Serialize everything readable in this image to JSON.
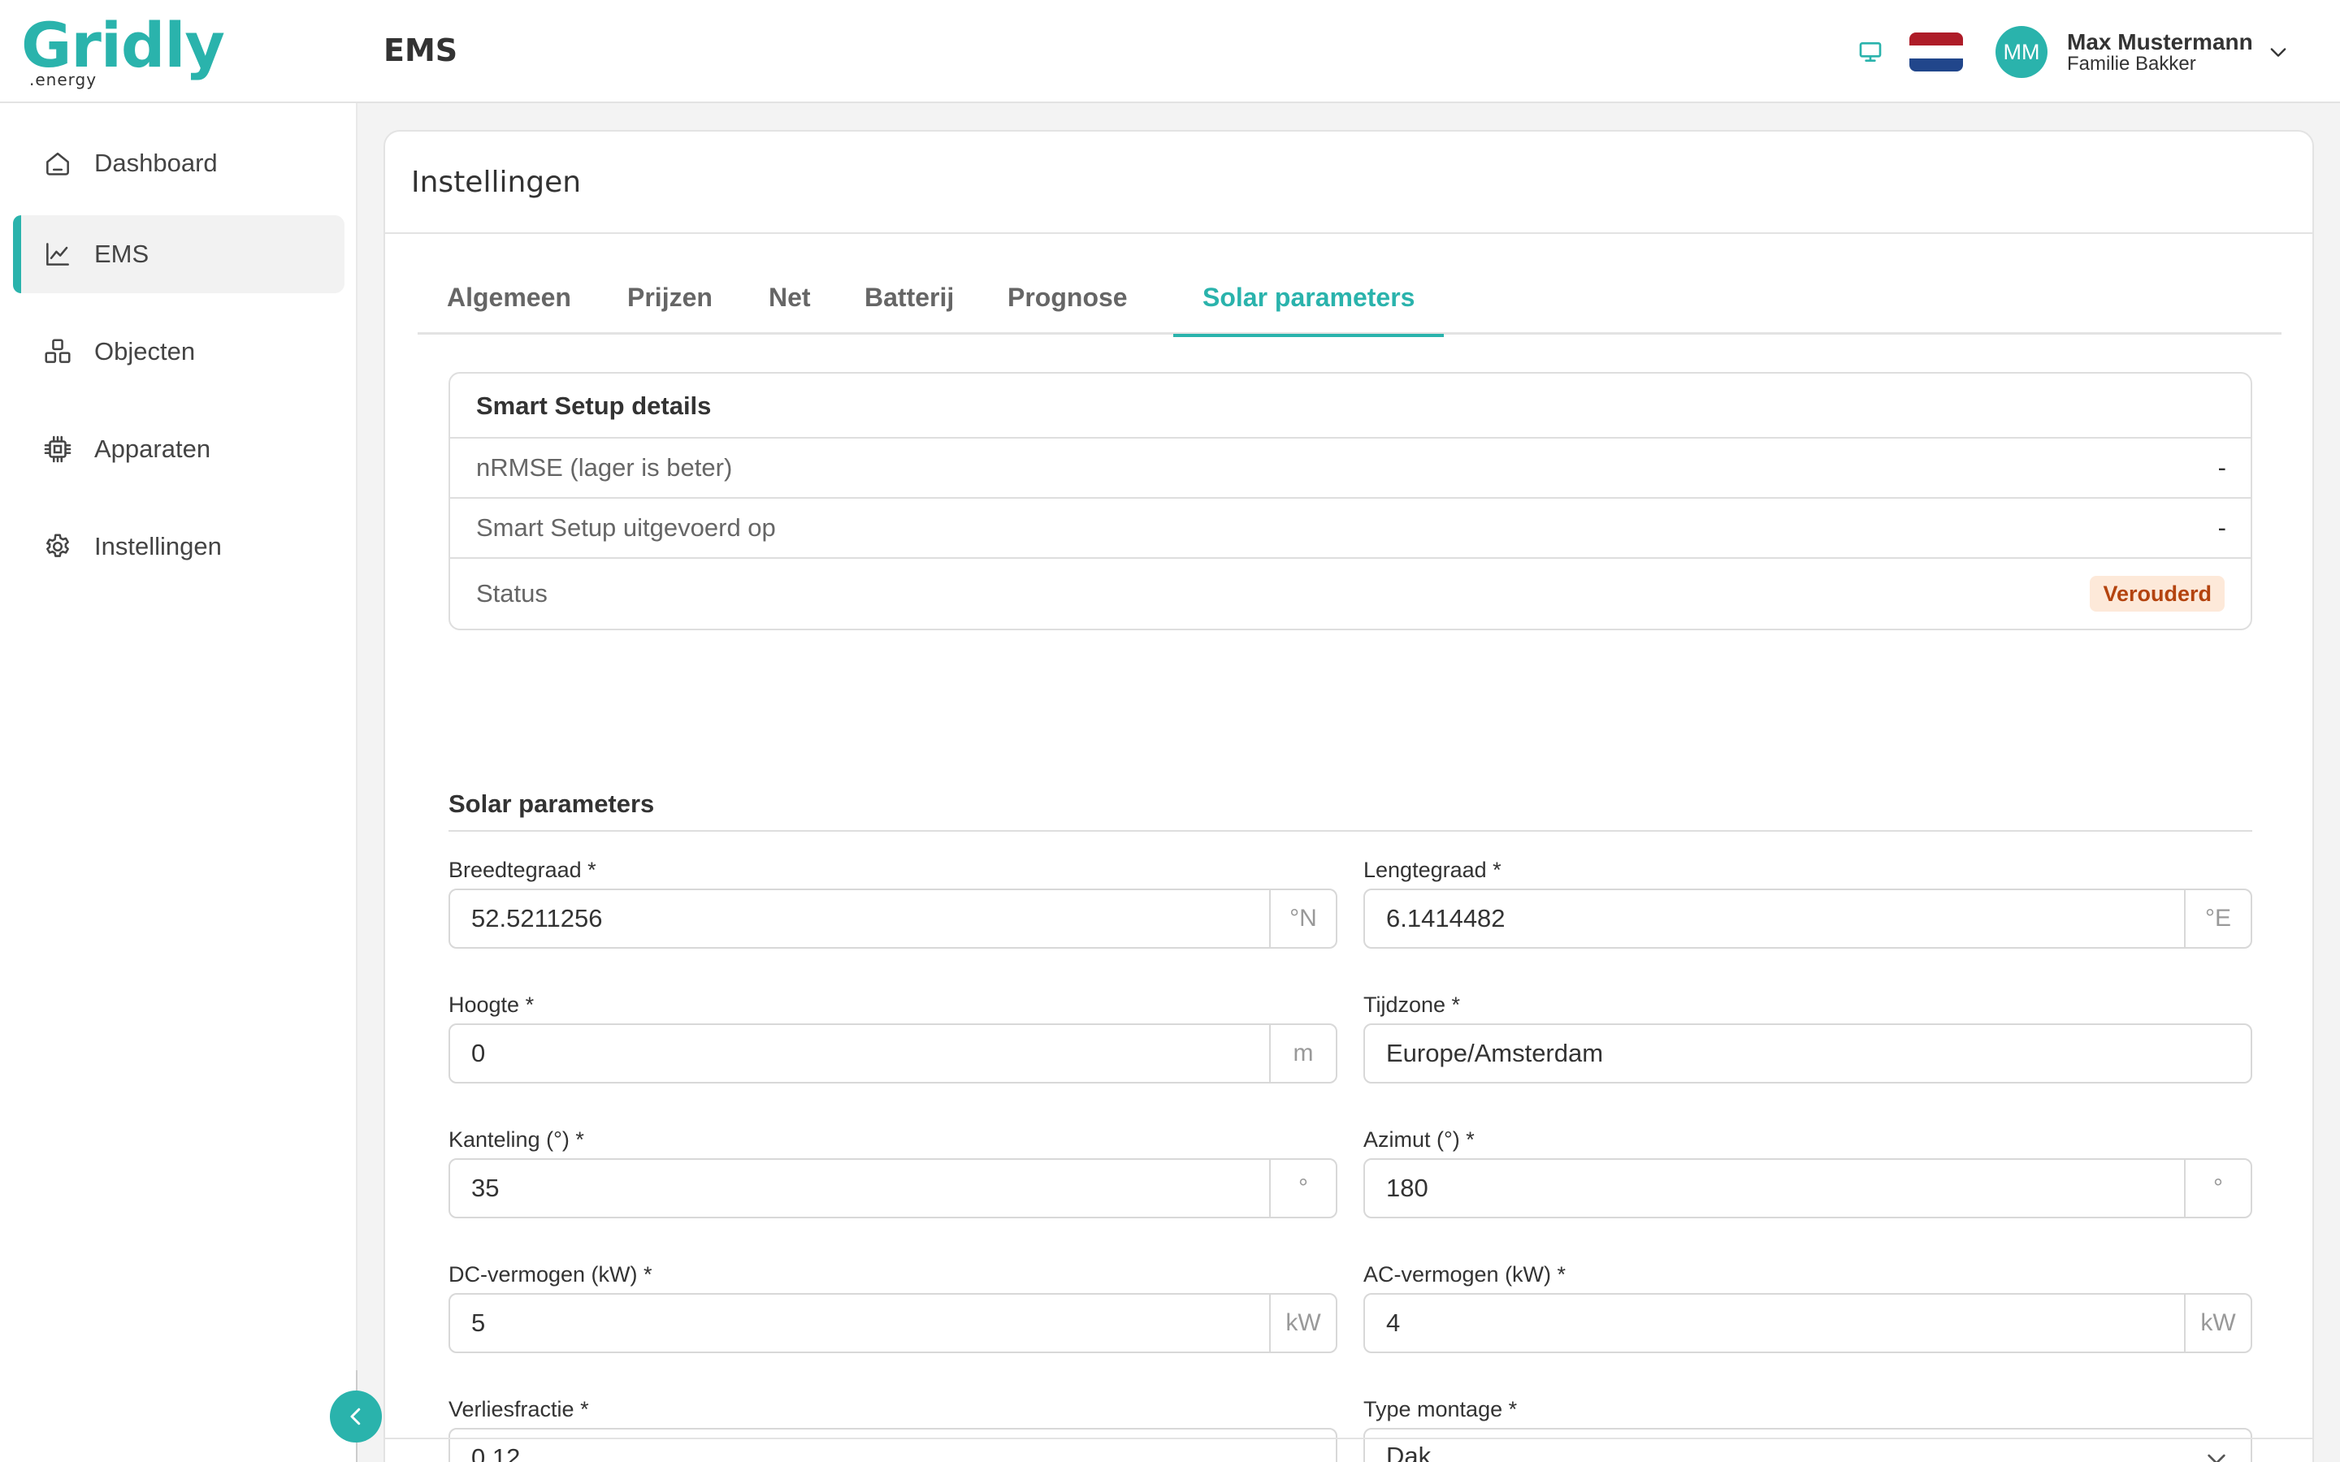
{
  "app": {
    "logo_main": "Gridly",
    "logo_sub": ".energy",
    "page_title": "EMS"
  },
  "header": {
    "icons": [
      "monitor-icon",
      "dutch-flag"
    ],
    "flag_colors": [
      "#ae1c28",
      "#ffffff",
      "#21468b"
    ],
    "user": {
      "initials": "MM",
      "name": "Max Mustermann",
      "family": "Familie Bakker"
    }
  },
  "sidebar": {
    "items": [
      {
        "label": "Dashboard",
        "icon": "home-icon",
        "active": false
      },
      {
        "label": "EMS",
        "icon": "chart-line-icon",
        "active": true
      },
      {
        "label": "Objecten",
        "icon": "objects-icon",
        "active": false
      },
      {
        "label": "Apparaten",
        "icon": "chip-icon",
        "active": false
      },
      {
        "label": "Instellingen",
        "icon": "gear-icon",
        "active": false
      }
    ]
  },
  "card": {
    "title": "Instellingen"
  },
  "tabs": [
    {
      "label": "Algemeen",
      "active": false
    },
    {
      "label": "Prijzen",
      "active": false
    },
    {
      "label": "Net",
      "active": false
    },
    {
      "label": "Batterij",
      "active": false
    },
    {
      "label": "Prognose",
      "active": false
    },
    {
      "label": "Solar parameters",
      "active": true
    }
  ],
  "smart_setup": {
    "title": "Smart Setup details",
    "rows": [
      {
        "label": "nRMSE (lager is beter)",
        "value": "-"
      },
      {
        "label": "Smart Setup uitgevoerd op",
        "value": "-"
      },
      {
        "label": "Status",
        "badge": "Verouderd"
      }
    ]
  },
  "solar": {
    "title": "Solar parameters",
    "fields": {
      "latitude": {
        "label": "Breedtegraad *",
        "value": "52.5211256",
        "unit": "°N"
      },
      "longitude": {
        "label": "Lengtegraad *",
        "value": "6.1414482",
        "unit": "°E"
      },
      "altitude": {
        "label": "Hoogte *",
        "value": "0",
        "unit": "m"
      },
      "timezone": {
        "label": "Tijdzone *",
        "value": "Europe/Amsterdam"
      },
      "tilt": {
        "label": "Kanteling (°) *",
        "value": "35",
        "unit": "°"
      },
      "azimuth": {
        "label": "Azimut (°) *",
        "value": "180",
        "unit": "°"
      },
      "dc_power": {
        "label": "DC-vermogen (kW) *",
        "value": "5",
        "unit": "kW"
      },
      "ac_power": {
        "label": "AC-vermogen (kW) *",
        "value": "4",
        "unit": "kW"
      },
      "loss_fraction": {
        "label": "Verliesfractie *",
        "value": "0.12"
      },
      "mount_type": {
        "label": "Type montage *",
        "value": "Dak"
      }
    }
  },
  "colors": {
    "accent": "#2ab3ac",
    "badge_bg": "#fde9d9",
    "badge_text": "#b4440f"
  }
}
